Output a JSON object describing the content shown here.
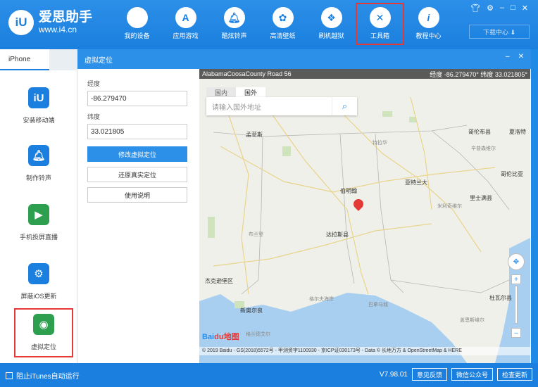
{
  "app": {
    "name": "爱思助手",
    "url": "www.i4.cn"
  },
  "nav": {
    "items": [
      {
        "label": "我的设备",
        "icon": "apple-icon"
      },
      {
        "label": "应用游戏",
        "icon": "app-store-icon"
      },
      {
        "label": "酷炫铃声",
        "icon": "bell-icon"
      },
      {
        "label": "高清壁纸",
        "icon": "wallpaper-icon"
      },
      {
        "label": "刷机越狱",
        "icon": "box-icon"
      },
      {
        "label": "工具箱",
        "icon": "tools-icon"
      },
      {
        "label": "教程中心",
        "icon": "info-icon"
      }
    ],
    "download_center": "下载中心 ⬇"
  },
  "sidebar": {
    "device_tab": "iPhone",
    "items": [
      {
        "label": "安装移动端",
        "icon": "iu-icon",
        "color": "#1a7fde"
      },
      {
        "label": "制作铃声",
        "icon": "bell-icon",
        "color": "#1a7fde"
      },
      {
        "label": "手机投屏直播",
        "icon": "screen-mirror-icon",
        "color": "#2e9e4f"
      },
      {
        "label": "屏蔽iOS更新",
        "icon": "gear-icon",
        "color": "#1a7fde"
      },
      {
        "label": "虚拟定位",
        "icon": "location-icon",
        "color": "#2e9e4f"
      }
    ]
  },
  "panel": {
    "title": "虚拟定位",
    "longitude_label": "经度",
    "longitude_value": "-86.279470",
    "latitude_label": "纬度",
    "latitude_value": "33.021805",
    "modify_button": "修改虚拟定位",
    "restore_button": "还原真实定位",
    "help_button": "使用说明"
  },
  "map": {
    "top_label": "AlabamaCoosaCounty Road 56",
    "coord_text": "经度 -86.279470°   纬度 33.021805°",
    "tabs": [
      "国内",
      "国外"
    ],
    "search_placeholder": "请输入国外地址",
    "places": [
      {
        "name": "孟菲斯",
        "cls": ""
      },
      {
        "name": "哥伦布县",
        "cls": ""
      },
      {
        "name": "夏洛特",
        "cls": ""
      },
      {
        "name": "亚特兰大",
        "cls": ""
      },
      {
        "name": "伯明翰",
        "cls": ""
      },
      {
        "name": "哥伦比亚",
        "cls": ""
      },
      {
        "name": "里士满县",
        "cls": ""
      },
      {
        "name": "达拉斯县",
        "cls": ""
      },
      {
        "name": "杰克逊堡区",
        "cls": ""
      },
      {
        "name": "新奥尔良",
        "cls": ""
      },
      {
        "name": "杜瓦尔县",
        "cls": ""
      },
      {
        "name": "特拉华",
        "cls": "small"
      },
      {
        "name": "辛普森维尔",
        "cls": "small"
      },
      {
        "name": "米利奇维尔",
        "cls": "small"
      },
      {
        "name": "布兰登",
        "cls": "small"
      },
      {
        "name": "巴拿马城",
        "cls": "small"
      },
      {
        "name": "盖恩斯维尔",
        "cls": "small"
      },
      {
        "name": "格尔夫海岸",
        "cls": "small"
      },
      {
        "name": "格兰德艾尔",
        "cls": "small"
      }
    ],
    "baidu": "Bai",
    "baidu_suffix": "du地图",
    "copyright": "© 2019 Baidu - GS(2018)5572号 - 甲测资字1100930 - 京ICP证030173号 - Data © 长地万方 & OpenStreetMap & HERE"
  },
  "footer": {
    "checkbox_label": "阻止iTunes自动运行",
    "version": "V7.98.01",
    "feedback": "意见反馈",
    "wechat": "微信公众号",
    "update": "检查更新"
  },
  "colors": {
    "accent": "#2c8fe8",
    "highlight": "#e53935"
  }
}
